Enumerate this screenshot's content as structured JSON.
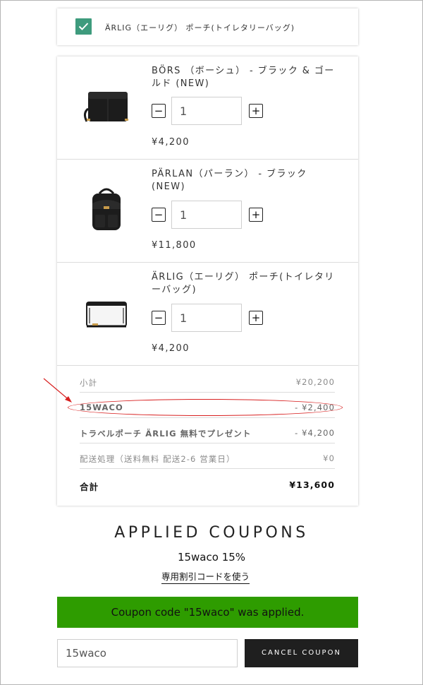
{
  "gift": {
    "checked": true,
    "label": "ÄRLIG（エーリグ） ポーチ(トイレタリーバッグ)"
  },
  "items": [
    {
      "name": "BÖRS （ボーシュ） - ブラック & ゴールド (NEW)",
      "quantity": "1",
      "price": "¥4,200",
      "thumb_icon": "black-wallet-image"
    },
    {
      "name": "PÄRLAN（パーラン） - ブラック (NEW)",
      "quantity": "1",
      "price": "¥11,800",
      "thumb_icon": "black-backpack-image"
    },
    {
      "name": "ÄRLIG（エーリグ） ポーチ(トイレタリーバッグ)",
      "quantity": "1",
      "price": "¥4,200",
      "thumb_icon": "clear-pouch-image"
    }
  ],
  "totals": {
    "subtotal_label": "小計",
    "subtotal_value": "¥20,200",
    "coupon_label": "15WACO",
    "coupon_value": "- ¥2,400",
    "gift_label": "トラベルポーチ ÄRLIG 無料でプレゼント",
    "gift_value": "- ¥4,200",
    "shipping_label": "配送処理（送料無料 配送2-6 営業日）",
    "shipping_value": "¥0",
    "total_label": "合計",
    "total_value": "¥13,600"
  },
  "applied": {
    "title": "APPLIED COUPONS",
    "code_text": "15waco 15%",
    "use_code_link": "専用割引コードを使う",
    "success_message": "Coupon code \"15waco\" was applied.",
    "input_value": "15waco",
    "cancel_label": "CANCEL COUPON"
  },
  "colors": {
    "check_green": "#3e9b7d",
    "success_green": "#2e9c00",
    "annotation_red": "#d82020",
    "button_dark": "#1f1f1f"
  }
}
